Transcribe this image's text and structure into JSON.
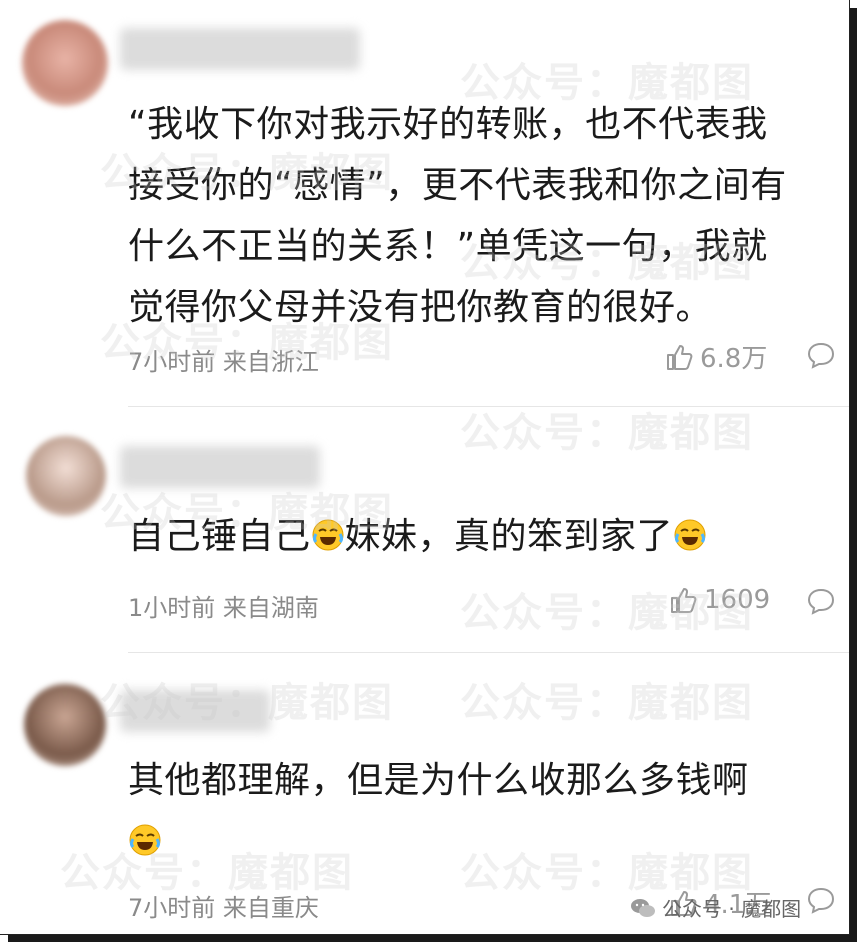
{
  "comments": [
    {
      "text_lines": [
        "“我收下你对我示好的转账，也不代表我",
        "接受你的“感情”，更不代表我和你之间有",
        "什么不正当的关系！”单凭这一句，我就",
        "觉得你父母并没有把你教育的很好。"
      ],
      "meta": "7小时前 来自浙江",
      "likes": "6.8万",
      "avatar_color": "#c98a7a"
    },
    {
      "text_a": "自己锤自己",
      "text_b": "妹妹，真的笨到家了",
      "meta": "1小时前 来自湖南",
      "likes": "1609",
      "avatar_color": "#b99a8a"
    },
    {
      "text_line": "其他都理解，但是为什么收那么多钱啊",
      "meta": "7小时前 来自重庆",
      "likes": "4.1万",
      "avatar_color": "#7a5a4a"
    }
  ],
  "watermark": "公众号：魔都图",
  "badge": {
    "label": "公众号 · 魔都图"
  },
  "icons": {
    "like": "thumbs-up-icon",
    "reply": "reply-bubble-icon",
    "emoji": "laughing-crying-emoji"
  }
}
